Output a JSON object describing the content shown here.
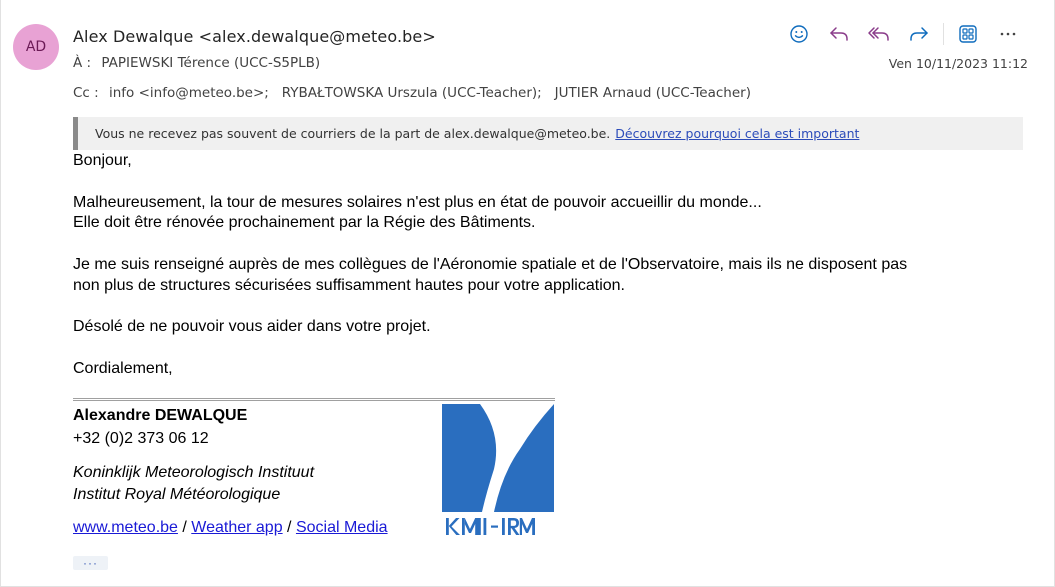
{
  "sender": {
    "initials": "AD",
    "display": "Alex Dewalque <alex.dewalque@meteo.be>",
    "avatar_color": "#e8a2d4"
  },
  "recipients": {
    "to_label": "À :",
    "to": "PAPIEWSKI Térence (UCC-S5PLB)",
    "cc_label": "Cc :",
    "cc": "info <info@meteo.be>;   RYBAŁTOWSKA Urszula (UCC-Teacher);   JUTIER Arnaud (UCC-Teacher)"
  },
  "date": "Ven 10/11/2023 11:12",
  "toolbar": {
    "icons": [
      "emoji-icon",
      "reply-icon",
      "reply-all-icon",
      "forward-icon",
      "apps-icon",
      "more-icon"
    ],
    "accent_color": "#0f6cbd",
    "reply_color": "#8a3c8a"
  },
  "banner": {
    "text": "Vous ne recevez pas souvent de courriers de la part de alex.dewalque@meteo.be.",
    "link": "Découvrez pourquoi cela est important"
  },
  "body": {
    "greeting": "Bonjour,",
    "p1_line1": "Malheureusement, la tour de mesures solaires n'est plus en état de pouvoir accueillir du monde...",
    "p1_line2": "Elle doit être rénovée prochainement par la Régie des Bâtiments.",
    "p2_line1": "Je me suis renseigné auprès de mes collègues de l'Aéronomie spatiale et de l'Observatoire, mais ils ne disposent pas",
    "p2_line2": "non plus de structures sécurisées suffisamment hautes pour votre application.",
    "p3": "Désolé de ne pouvoir vous aider dans votre projet.",
    "closing": "Cordialement,"
  },
  "signature": {
    "name": "Alexandre DEWALQUE",
    "phone": "+32 (0)2 373 06 12",
    "org_nl": "Koninklijk Meteorologisch Instituut",
    "org_fr": "Institut Royal Météorologique",
    "link1": "www.meteo.be",
    "sep": " / ",
    "link2": "Weather app",
    "link3": "Social Media",
    "logo_text": "KMI-IRM",
    "logo_color": "#2a6ebf"
  },
  "more_label": "···"
}
